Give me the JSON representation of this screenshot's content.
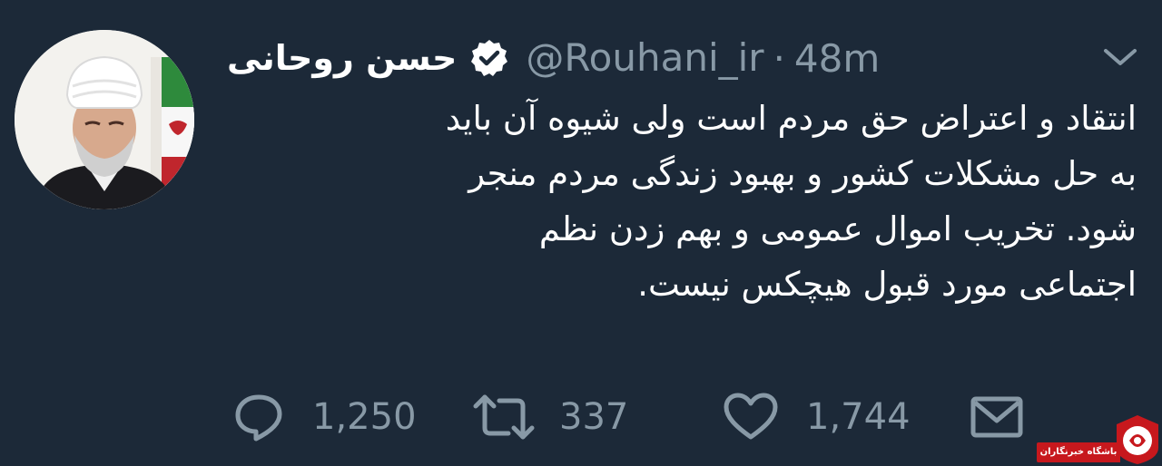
{
  "tweet": {
    "display_name": "حسن روحانی",
    "handle": "@Rouhani_ir",
    "separator": "·",
    "time": "48m",
    "text": "انتقاد و اعتراض حق مردم است ولی شیوه آن باید\nبه حل مشکلات کشور و بهبود زندگی مردم منجر\nشود. تخریب اموال عمومی و بهم زدن نظم\nاجتماعی مورد قبول هیچکس نیست."
  },
  "actions": {
    "replies": "1,250",
    "retweets": "337",
    "likes": "1,744"
  },
  "watermark": {
    "label": "باشگاه خبرنگاران"
  },
  "colors": {
    "background": "#1c2938",
    "text": "#ffffff",
    "muted": "#8899a6",
    "watermark_red": "#c7181d"
  },
  "icons": {
    "verified": "verified-badge-icon",
    "caret": "chevron-down-icon",
    "reply": "reply-icon",
    "retweet": "retweet-icon",
    "like": "heart-icon",
    "dm": "envelope-icon"
  }
}
